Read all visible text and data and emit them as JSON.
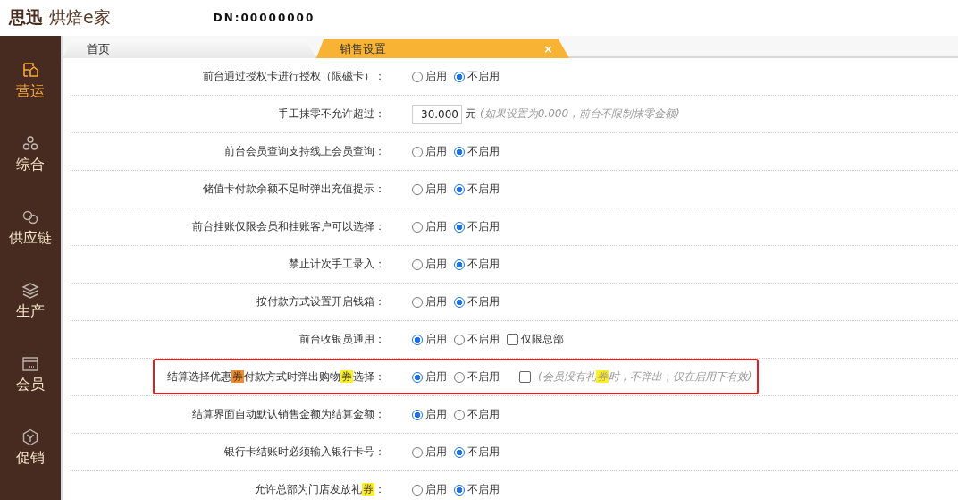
{
  "header": {
    "logo_primary": "思迅",
    "logo_secondary": "烘焙e家",
    "device": "DN:00000000"
  },
  "sidebar": {
    "items": [
      {
        "label": "营运",
        "selected": true
      },
      {
        "label": "综合",
        "selected": false
      },
      {
        "label": "供应链",
        "selected": false
      },
      {
        "label": "生产",
        "selected": false
      },
      {
        "label": "会员",
        "selected": false
      },
      {
        "label": "促销",
        "selected": false
      }
    ]
  },
  "tabs": [
    {
      "label": "首页",
      "selected": false
    },
    {
      "label": "销售设置",
      "selected": true,
      "close": "×"
    }
  ],
  "rows": [
    {
      "kind": "radio",
      "label": "前台通过授权卡进行授权（限磁卡）：",
      "options": [
        {
          "label": "启用",
          "selected": false
        },
        {
          "label": "不启用",
          "selected": true
        }
      ]
    },
    {
      "kind": "amount",
      "label": "手工抹零不允许超过：",
      "value": "30.000",
      "unit": "元",
      "hint": "(如果设置为0.000，前台不限制抹零金额)"
    },
    {
      "kind": "radio",
      "label": "前台会员查询支持线上会员查询：",
      "options": [
        {
          "label": "启用",
          "selected": false
        },
        {
          "label": "不启用",
          "selected": true
        }
      ]
    },
    {
      "kind": "radio",
      "label": "储值卡付款余额不足时弹出充值提示：",
      "options": [
        {
          "label": "启用",
          "selected": false
        },
        {
          "label": "不启用",
          "selected": true
        }
      ]
    },
    {
      "kind": "radio",
      "label": "前台挂账仅限会员和挂账客户可以选择：",
      "options": [
        {
          "label": "启用",
          "selected": false
        },
        {
          "label": "不启用",
          "selected": true
        }
      ]
    },
    {
      "kind": "radio",
      "label": "禁止计次手工录入：",
      "options": [
        {
          "label": "启用",
          "selected": false
        },
        {
          "label": "不启用",
          "selected": true
        }
      ]
    },
    {
      "kind": "radio",
      "label": "按付款方式设置开启钱箱：",
      "options": [
        {
          "label": "启用",
          "selected": false
        },
        {
          "label": "不启用",
          "selected": true
        }
      ]
    },
    {
      "kind": "radio",
      "label": "前台收银员通用：",
      "options": [
        {
          "label": "启用",
          "selected": true
        },
        {
          "label": "不启用",
          "selected": false
        }
      ],
      "checkbox": {
        "label": "仅限总部",
        "checked": false
      }
    },
    {
      "kind": "radio",
      "outlined": true,
      "label_parts": [
        {
          "text": "结算选择优惠"
        },
        {
          "text": "券",
          "color": "#f08c2c"
        },
        {
          "text": "付款方式时弹出购物"
        },
        {
          "text": "券",
          "color": "#ffee22"
        },
        {
          "text": "选择："
        }
      ],
      "options": [
        {
          "label": "启用",
          "selected": true
        },
        {
          "label": "不启用",
          "selected": false
        }
      ],
      "checkbox": {
        "checked": false,
        "hint_parts": [
          {
            "text": "(会员没有礼"
          },
          {
            "text": "券",
            "color": "#ffee22"
          },
          {
            "text": "时，不弹出，仅在启用下有效)"
          }
        ]
      }
    },
    {
      "kind": "radio",
      "label": "结算界面自动默认销售金额为结算金额：",
      "options": [
        {
          "label": "启用",
          "selected": true
        },
        {
          "label": "不启用",
          "selected": false
        }
      ]
    },
    {
      "kind": "radio",
      "label": "银行卡结账时必须输入银行卡号：",
      "options": [
        {
          "label": "启用",
          "selected": false
        },
        {
          "label": "不启用",
          "selected": true
        }
      ]
    },
    {
      "kind": "radio",
      "label_parts": [
        {
          "text": "允许总部为门店发放礼"
        },
        {
          "text": "券",
          "color": "#ffee22"
        },
        {
          "text": "："
        }
      ],
      "options": [
        {
          "label": "启用",
          "selected": false
        },
        {
          "label": "不启用",
          "selected": true
        }
      ]
    }
  ]
}
